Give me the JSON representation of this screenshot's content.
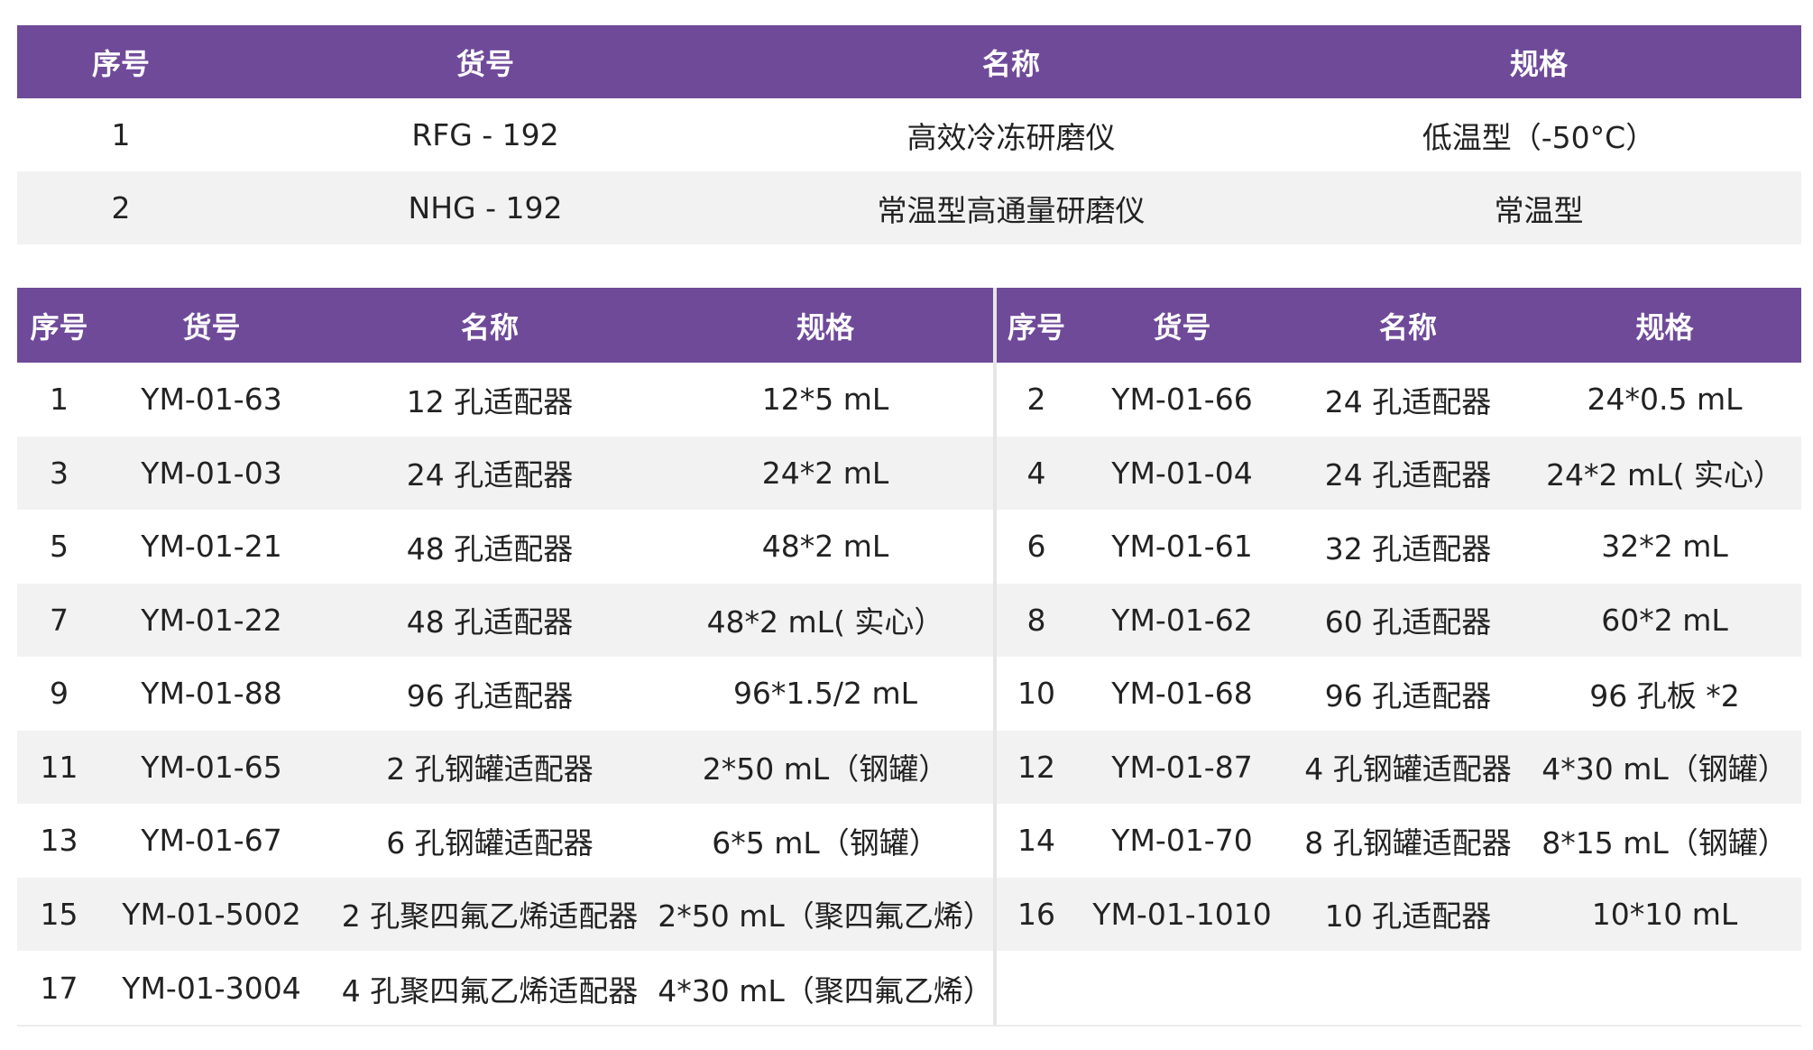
{
  "colors": {
    "header": "#6f4a99",
    "header_text": "#ffffff",
    "stripe": "#f2f2f2"
  },
  "table1": {
    "headers": [
      "序号",
      "货号",
      "名称",
      "规格"
    ],
    "rows": [
      [
        "1",
        "RFG - 192",
        "高效冷冻研磨仪",
        "低温型（-50°C）"
      ],
      [
        "2",
        "NHG - 192",
        "常温型高通量研磨仪",
        "常温型"
      ]
    ]
  },
  "table2": {
    "headers": [
      "序号",
      "货号",
      "名称",
      "规格"
    ],
    "left_rows": [
      [
        "1",
        "YM-01-63",
        "12 孔适配器",
        "12*5 mL"
      ],
      [
        "3",
        "YM-01-03",
        "24 孔适配器",
        "24*2 mL"
      ],
      [
        "5",
        "YM-01-21",
        "48 孔适配器",
        "48*2 mL"
      ],
      [
        "7",
        "YM-01-22",
        "48 孔适配器",
        "48*2 mL( 实心）"
      ],
      [
        "9",
        "YM-01-88",
        "96 孔适配器",
        "96*1.5/2 mL"
      ],
      [
        "11",
        "YM-01-65",
        "2 孔钢罐适配器",
        "2*50 mL（钢罐）"
      ],
      [
        "13",
        "YM-01-67",
        "6 孔钢罐适配器",
        "6*5 mL（钢罐）"
      ],
      [
        "15",
        "YM-01-5002",
        "2 孔聚四氟乙烯适配器",
        "2*50 mL（聚四氟乙烯）"
      ],
      [
        "17",
        "YM-01-3004",
        "4 孔聚四氟乙烯适配器",
        "4*30 mL（聚四氟乙烯）"
      ]
    ],
    "right_rows": [
      [
        "2",
        "YM-01-66",
        "24 孔适配器",
        "24*0.5 mL"
      ],
      [
        "4",
        "YM-01-04",
        "24 孔适配器",
        "24*2 mL( 实心）"
      ],
      [
        "6",
        "YM-01-61",
        "32 孔适配器",
        "32*2 mL"
      ],
      [
        "8",
        "YM-01-62",
        "60 孔适配器",
        "60*2 mL"
      ],
      [
        "10",
        "YM-01-68",
        "96 孔适配器",
        "96 孔板 *2"
      ],
      [
        "12",
        "YM-01-87",
        "4 孔钢罐适配器",
        "4*30 mL（钢罐）"
      ],
      [
        "14",
        "YM-01-70",
        "8 孔钢罐适配器",
        "8*15 mL（钢罐）"
      ],
      [
        "16",
        "YM-01-1010",
        "10 孔适配器",
        "10*10 mL"
      ]
    ]
  }
}
